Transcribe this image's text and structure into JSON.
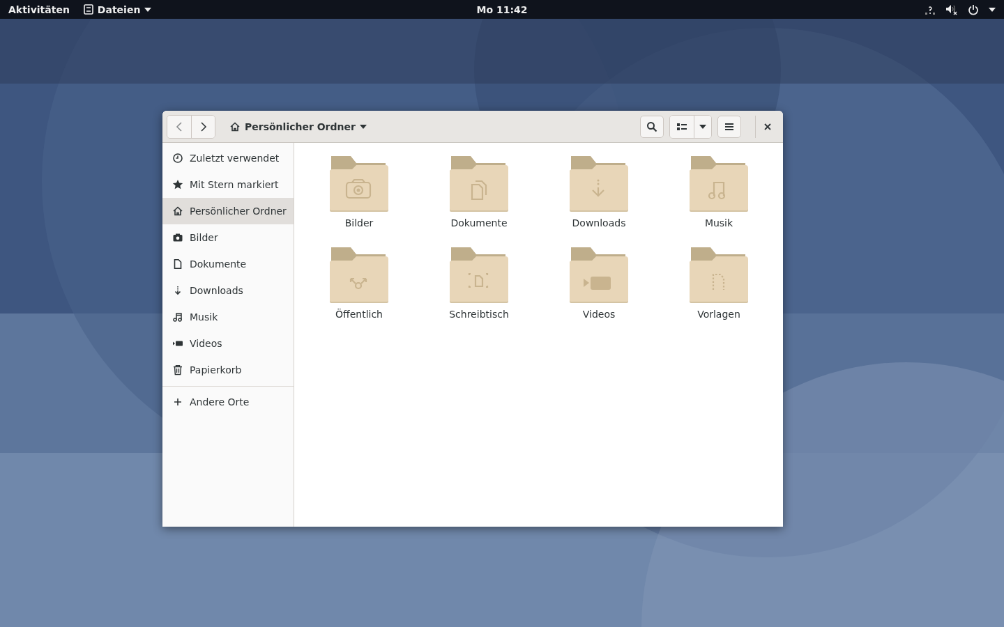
{
  "top_bar": {
    "activities": "Aktivitäten",
    "app_menu": "Dateien",
    "clock": "Mo 11:42"
  },
  "window": {
    "location": "Persönlicher Ordner",
    "sidebar": {
      "items": [
        {
          "label": "Zuletzt verwendet",
          "kind": "recent",
          "selected": false
        },
        {
          "label": "Mit Stern markiert",
          "kind": "starred",
          "selected": false
        },
        {
          "label": "Persönlicher Ordner",
          "kind": "home",
          "selected": true
        },
        {
          "label": "Bilder",
          "kind": "pictures",
          "selected": false
        },
        {
          "label": "Dokumente",
          "kind": "documents",
          "selected": false
        },
        {
          "label": "Downloads",
          "kind": "downloads",
          "selected": false
        },
        {
          "label": "Musik",
          "kind": "music",
          "selected": false
        },
        {
          "label": "Videos",
          "kind": "videos",
          "selected": false
        },
        {
          "label": "Papierkorb",
          "kind": "trash",
          "selected": false
        }
      ],
      "other": {
        "label": "Andere Orte",
        "kind": "other"
      }
    },
    "folders": [
      {
        "name": "Bilder",
        "kind": "pictures"
      },
      {
        "name": "Dokumente",
        "kind": "documents"
      },
      {
        "name": "Downloads",
        "kind": "downloads"
      },
      {
        "name": "Musik",
        "kind": "music"
      },
      {
        "name": "Öffentlich",
        "kind": "public"
      },
      {
        "name": "Schreibtisch",
        "kind": "desktop"
      },
      {
        "name": "Videos",
        "kind": "videos"
      },
      {
        "name": "Vorlagen",
        "kind": "templates"
      }
    ]
  }
}
